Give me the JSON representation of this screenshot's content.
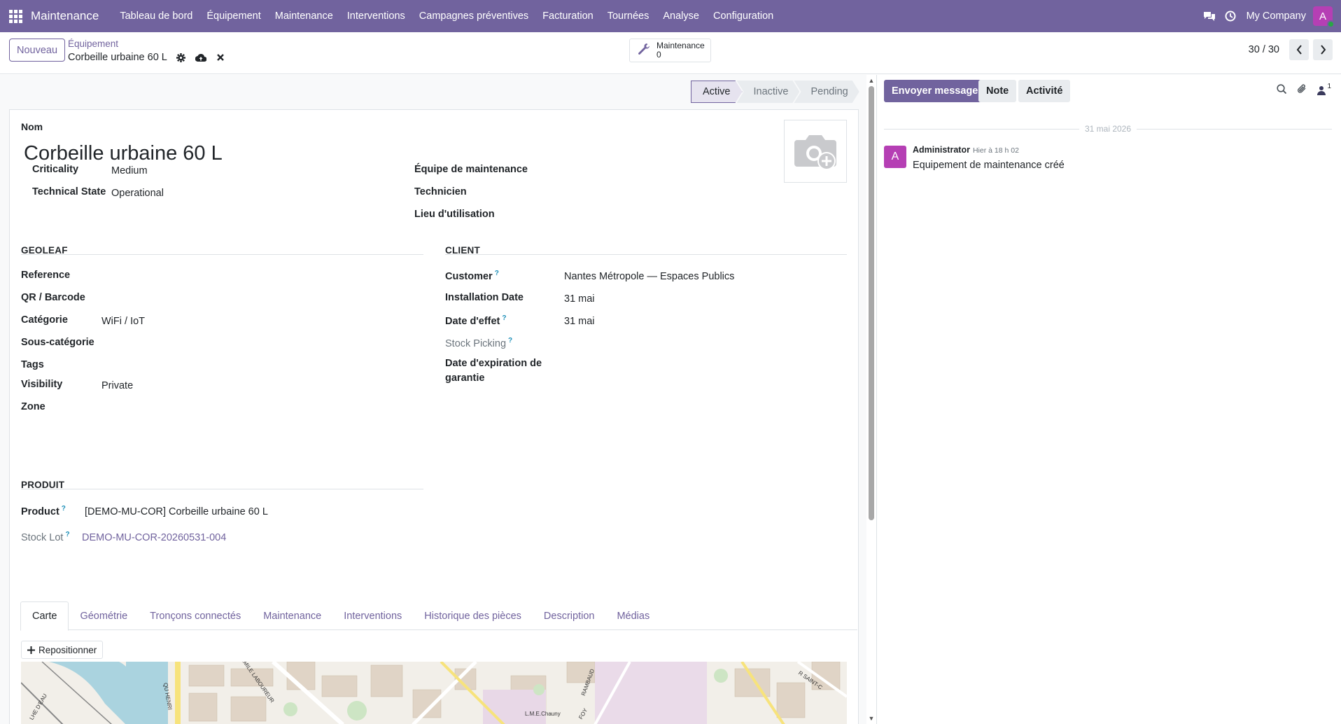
{
  "navbar": {
    "brand": "Maintenance",
    "menu": [
      "Tableau de bord",
      "Équipement",
      "Maintenance",
      "Interventions",
      "Campagnes préventives",
      "Facturation",
      "Tournées",
      "Analyse",
      "Configuration"
    ],
    "company": "My Company",
    "user_initial": "A",
    "accent_color": "#71639e"
  },
  "control": {
    "new_label": "Nouveau",
    "breadcrumb_parent": "Équipement",
    "breadcrumb_current": "Corbeille urbaine 60 L",
    "smart_button_label": "Maintenance",
    "smart_button_count": "0",
    "pager_value": "30 / 30"
  },
  "statusbar": {
    "stages": [
      "Active",
      "Inactive",
      "Pending"
    ],
    "current": "Active"
  },
  "form": {
    "name_label": "Nom",
    "name_value": "Corbeille urbaine 60 L",
    "criticality_label": "Criticality",
    "criticality_value": "Medium",
    "technical_state_label": "Technical State",
    "technical_state_value": "Operational",
    "team_label": "Équipe de maintenance",
    "technician_label": "Technicien",
    "location_label": "Lieu d'utilisation",
    "geoleaf": {
      "title": "GEOLEAF",
      "reference_label": "Reference",
      "qr_label": "QR / Barcode",
      "category_label": "Catégorie",
      "category_value": "WiFi / IoT",
      "subcategory_label": "Sous-catégorie",
      "tags_label": "Tags",
      "visibility_label": "Visibility",
      "visibility_value": "Private",
      "zone_label": "Zone"
    },
    "client": {
      "title": "CLIENT",
      "customer_label": "Customer",
      "customer_value": "Nantes Métropole — Espaces Publics",
      "installation_label": "Installation Date",
      "installation_value": "31 mai",
      "effect_label": "Date d'effet",
      "effect_value": "31 mai",
      "picking_label": "Stock Picking",
      "warranty_label_1": "Date d'expiration de",
      "warranty_label_2": "garantie"
    },
    "produit": {
      "title": "PRODUIT",
      "product_label": "Product",
      "product_value": "[DEMO-MU-COR] Corbeille urbaine 60 L",
      "lot_label": "Stock Lot",
      "lot_value": "DEMO-MU-COR-20260531-004"
    },
    "help_mark": "?"
  },
  "tabs": [
    "Carte",
    "Géométrie",
    "Tronçons connectés",
    "Maintenance",
    "Interventions",
    "Historique des pièces",
    "Description",
    "Médias"
  ],
  "map": {
    "reposition_label": "Repositionner",
    "street_labels": [
      "EMILE LABOUREUR",
      "QU HENRI",
      "RAMBAUD",
      "R SAINT-C",
      "LHE D'EAU",
      "L.M.E.Chauny",
      "FOY"
    ]
  },
  "chatter": {
    "send_label": "Envoyer message",
    "note_label": "Note",
    "activity_label": "Activité",
    "followers_count": "1",
    "date_separator": "31 mai 2026",
    "message": {
      "author": "Administrator",
      "time": "Hier à 18 h 02",
      "body": "Equipement de maintenance créé",
      "avatar_initial": "A"
    }
  }
}
